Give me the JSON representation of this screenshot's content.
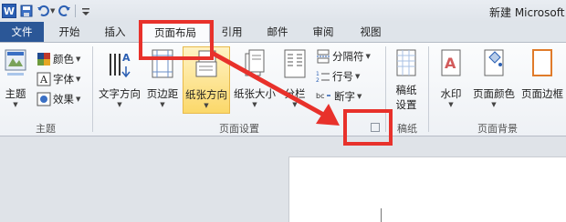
{
  "window": {
    "title": "新建 Microsoft"
  },
  "qat": {
    "logo": "W",
    "icons": [
      "word-logo-icon",
      "save-icon",
      "undo-icon",
      "redo-icon",
      "customize-icon"
    ]
  },
  "tabs": [
    "文件",
    "开始",
    "插入",
    "页面布局",
    "引用",
    "邮件",
    "审阅",
    "视图"
  ],
  "active_tab": "页面布局",
  "groups": {
    "theme": {
      "label": "主题",
      "theme_button": "主题",
      "colors": "颜色",
      "fonts": "字体",
      "effects": "效果"
    },
    "page_setup": {
      "label": "页面设置",
      "text_direction": "文字方向",
      "margins": "页边距",
      "orientation": "纸张方向",
      "size": "纸张大小",
      "columns": "分栏",
      "breaks": "分隔符",
      "line_numbers": "行号",
      "hyphenation": "断字"
    },
    "manuscript": {
      "label": "稿纸",
      "settings_line1": "稿纸",
      "settings_line2": "设置"
    },
    "page_background": {
      "label": "页面背景",
      "watermark": "水印",
      "page_color": "页面颜色",
      "page_borders": "页面边框"
    }
  },
  "annotation_color": "#e8312b",
  "accent_color": "#2b5797"
}
